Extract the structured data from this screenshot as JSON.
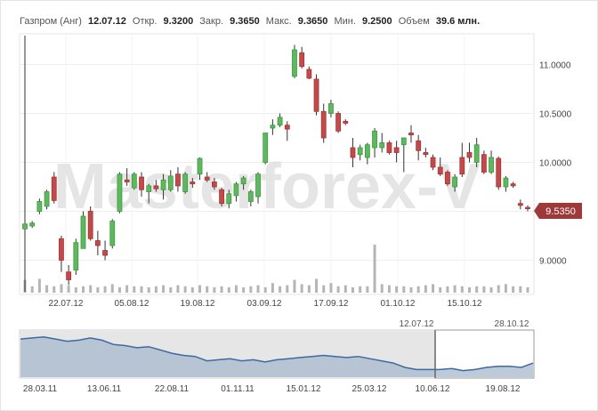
{
  "header": {
    "symbol_label": "Газпром (Анг)",
    "date": "12.07.12",
    "open_label": "Откр.",
    "open_value": "9.3200",
    "close_label": "Закр.",
    "close_value": "9.3650",
    "high_label": "Макс.",
    "high_value": "9.3650",
    "low_label": "Мин.",
    "low_value": "9.2500",
    "volume_label": "Объем",
    "volume_value": "39.6 млн."
  },
  "watermark": "Masterforex-V",
  "last_price_badge": "9.5350",
  "navigator": {
    "window_start_label": "12.07.12",
    "window_end_label": "28.10.12",
    "x_tick_labels": [
      "28.03.11",
      "13.06.11",
      "22.08.11",
      "01.11.11",
      "15.01.12",
      "25.03.12",
      "10.06.12",
      "19.08.12"
    ],
    "series_values": [
      9.5,
      9.6,
      9.7,
      9.5,
      9.3,
      9.4,
      9.6,
      9.4,
      9.0,
      8.9,
      8.7,
      8.8,
      8.5,
      8.2,
      8.0,
      7.9,
      7.5,
      7.6,
      7.7,
      7.5,
      7.6,
      7.4,
      7.6,
      7.7,
      7.8,
      7.9,
      8.0,
      7.9,
      7.8,
      7.9,
      7.7,
      7.5,
      7.3,
      6.9,
      6.7,
      6.7,
      6.7,
      6.8,
      6.6,
      6.7,
      6.9,
      7.0,
      7.0,
      6.9,
      7.3
    ]
  },
  "chart_data": {
    "type": "candlestick",
    "x_tick_labels": [
      "22.07.12",
      "05.08.12",
      "19.08.12",
      "03.09.12",
      "17.09.12",
      "01.10.12",
      "15.10.12"
    ],
    "y_tick_labels": [
      "11.0000",
      "10.5000",
      "10.0000",
      "9.5000",
      "9.0000"
    ],
    "ylim": [
      8.75,
      11.25
    ],
    "candles": [
      {
        "o": 9.32,
        "h": 9.37,
        "l": 9.25,
        "c": 9.37
      },
      {
        "o": 9.35,
        "h": 9.4,
        "l": 9.33,
        "c": 9.38
      },
      {
        "o": 9.5,
        "h": 9.63,
        "l": 9.47,
        "c": 9.6
      },
      {
        "o": 9.55,
        "h": 9.72,
        "l": 9.52,
        "c": 9.7
      },
      {
        "o": 9.85,
        "h": 9.9,
        "l": 9.58,
        "c": 9.61
      },
      {
        "o": 9.22,
        "h": 9.25,
        "l": 8.88,
        "c": 9.0
      },
      {
        "o": 8.88,
        "h": 8.95,
        "l": 8.75,
        "c": 8.8
      },
      {
        "o": 8.9,
        "h": 9.22,
        "l": 8.85,
        "c": 9.18
      },
      {
        "o": 9.12,
        "h": 9.5,
        "l": 9.12,
        "c": 9.45
      },
      {
        "o": 9.5,
        "h": 9.55,
        "l": 9.2,
        "c": 9.22
      },
      {
        "o": 9.2,
        "h": 9.3,
        "l": 9.05,
        "c": 9.15
      },
      {
        "o": 9.1,
        "h": 9.2,
        "l": 9.0,
        "c": 9.05
      },
      {
        "o": 9.15,
        "h": 9.42,
        "l": 9.12,
        "c": 9.4
      },
      {
        "o": 9.5,
        "h": 9.9,
        "l": 9.48,
        "c": 9.88
      },
      {
        "o": 9.82,
        "h": 9.94,
        "l": 9.76,
        "c": 9.8
      },
      {
        "o": 9.74,
        "h": 9.9,
        "l": 9.72,
        "c": 9.88
      },
      {
        "o": 9.85,
        "h": 9.9,
        "l": 9.65,
        "c": 9.72
      },
      {
        "o": 9.7,
        "h": 9.78,
        "l": 9.58,
        "c": 9.76
      },
      {
        "o": 9.76,
        "h": 9.82,
        "l": 9.7,
        "c": 9.73
      },
      {
        "o": 9.72,
        "h": 9.88,
        "l": 9.62,
        "c": 9.82
      },
      {
        "o": 9.72,
        "h": 9.92,
        "l": 9.7,
        "c": 9.86
      },
      {
        "o": 9.88,
        "h": 9.95,
        "l": 9.7,
        "c": 9.76
      },
      {
        "o": 9.7,
        "h": 9.9,
        "l": 9.68,
        "c": 9.88
      },
      {
        "o": 9.8,
        "h": 9.84,
        "l": 9.74,
        "c": 9.78
      },
      {
        "o": 9.88,
        "h": 10.05,
        "l": 9.82,
        "c": 10.04
      },
      {
        "o": 9.85,
        "h": 9.9,
        "l": 9.8,
        "c": 9.82
      },
      {
        "o": 9.8,
        "h": 9.84,
        "l": 9.72,
        "c": 9.75
      },
      {
        "o": 9.72,
        "h": 9.74,
        "l": 9.55,
        "c": 9.58
      },
      {
        "o": 9.58,
        "h": 9.72,
        "l": 9.53,
        "c": 9.68
      },
      {
        "o": 9.66,
        "h": 9.8,
        "l": 9.6,
        "c": 9.78
      },
      {
        "o": 9.78,
        "h": 9.86,
        "l": 9.72,
        "c": 9.84
      },
      {
        "o": 9.6,
        "h": 9.72,
        "l": 9.55,
        "c": 9.7
      },
      {
        "o": 9.65,
        "h": 9.9,
        "l": 9.58,
        "c": 9.88
      },
      {
        "o": 10.0,
        "h": 10.3,
        "l": 9.98,
        "c": 10.3
      },
      {
        "o": 10.35,
        "h": 10.44,
        "l": 10.28,
        "c": 10.38
      },
      {
        "o": 10.38,
        "h": 10.5,
        "l": 10.36,
        "c": 10.46
      },
      {
        "o": 10.38,
        "h": 10.42,
        "l": 10.22,
        "c": 10.34
      },
      {
        "o": 10.88,
        "h": 11.2,
        "l": 10.86,
        "c": 11.15
      },
      {
        "o": 11.12,
        "h": 11.18,
        "l": 10.96,
        "c": 10.98
      },
      {
        "o": 10.95,
        "h": 10.98,
        "l": 10.85,
        "c": 10.86
      },
      {
        "o": 10.85,
        "h": 10.9,
        "l": 10.48,
        "c": 10.52
      },
      {
        "o": 10.52,
        "h": 10.6,
        "l": 10.2,
        "c": 10.25
      },
      {
        "o": 10.5,
        "h": 10.64,
        "l": 10.46,
        "c": 10.6
      },
      {
        "o": 10.5,
        "h": 10.52,
        "l": 10.3,
        "c": 10.32
      },
      {
        "o": 10.42,
        "h": 10.44,
        "l": 10.38,
        "c": 10.4
      },
      {
        "o": 10.15,
        "h": 10.25,
        "l": 9.95,
        "c": 10.05
      },
      {
        "o": 10.08,
        "h": 10.18,
        "l": 10.02,
        "c": 10.15
      },
      {
        "o": 10.05,
        "h": 10.2,
        "l": 9.98,
        "c": 10.18
      },
      {
        "o": 10.15,
        "h": 10.35,
        "l": 10.05,
        "c": 10.32
      },
      {
        "o": 10.15,
        "h": 10.3,
        "l": 10.1,
        "c": 10.2
      },
      {
        "o": 10.2,
        "h": 10.22,
        "l": 10.08,
        "c": 10.1
      },
      {
        "o": 10.15,
        "h": 10.22,
        "l": 10.0,
        "c": 10.1
      },
      {
        "o": 10.18,
        "h": 10.25,
        "l": 9.9,
        "c": 10.25
      },
      {
        "o": 10.3,
        "h": 10.38,
        "l": 10.2,
        "c": 10.28
      },
      {
        "o": 10.22,
        "h": 10.28,
        "l": 10.02,
        "c": 10.12
      },
      {
        "o": 10.1,
        "h": 10.15,
        "l": 10.05,
        "c": 10.08
      },
      {
        "o": 10.05,
        "h": 10.08,
        "l": 9.92,
        "c": 9.95
      },
      {
        "o": 9.95,
        "h": 10.05,
        "l": 9.86,
        "c": 9.88
      },
      {
        "o": 9.9,
        "h": 9.92,
        "l": 9.76,
        "c": 9.78
      },
      {
        "o": 9.75,
        "h": 9.88,
        "l": 9.7,
        "c": 9.85
      },
      {
        "o": 10.05,
        "h": 10.2,
        "l": 9.85,
        "c": 9.88
      },
      {
        "o": 10.1,
        "h": 10.2,
        "l": 10.0,
        "c": 10.05
      },
      {
        "o": 10.0,
        "h": 10.25,
        "l": 9.95,
        "c": 10.18
      },
      {
        "o": 10.08,
        "h": 10.12,
        "l": 9.88,
        "c": 9.9
      },
      {
        "o": 9.9,
        "h": 10.12,
        "l": 9.88,
        "c": 10.05
      },
      {
        "o": 10.04,
        "h": 10.06,
        "l": 9.72,
        "c": 9.75
      },
      {
        "o": 9.75,
        "h": 9.86,
        "l": 9.7,
        "c": 9.84
      },
      {
        "o": 9.78,
        "h": 9.8,
        "l": 9.74,
        "c": 9.76
      },
      {
        "o": 9.58,
        "h": 9.62,
        "l": 9.52,
        "c": 9.56
      },
      {
        "o": 9.54,
        "h": 9.56,
        "l": 9.5,
        "c": 9.535
      }
    ],
    "volumes": [
      0.12,
      0.06,
      0.13,
      0.07,
      0.06,
      0.08,
      0.07,
      0.05,
      0.06,
      0.07,
      0.05,
      0.06,
      0.08,
      0.05,
      0.07,
      0.06,
      0.06,
      0.05,
      0.06,
      0.07,
      0.05,
      0.07,
      0.06,
      0.05,
      0.07,
      0.06,
      0.05,
      0.06,
      0.05,
      0.07,
      0.05,
      0.06,
      0.07,
      0.05,
      0.09,
      0.06,
      0.07,
      0.12,
      0.08,
      0.07,
      0.13,
      0.07,
      0.09,
      0.06,
      0.07,
      0.05,
      0.06,
      0.06,
      0.45,
      0.08,
      0.07,
      0.06,
      0.06,
      0.05,
      0.06,
      0.07,
      0.08,
      0.05,
      0.06,
      0.07,
      0.06,
      0.05,
      0.06,
      0.06,
      0.05,
      0.07,
      0.08,
      0.06,
      0.06,
      0.05
    ]
  }
}
